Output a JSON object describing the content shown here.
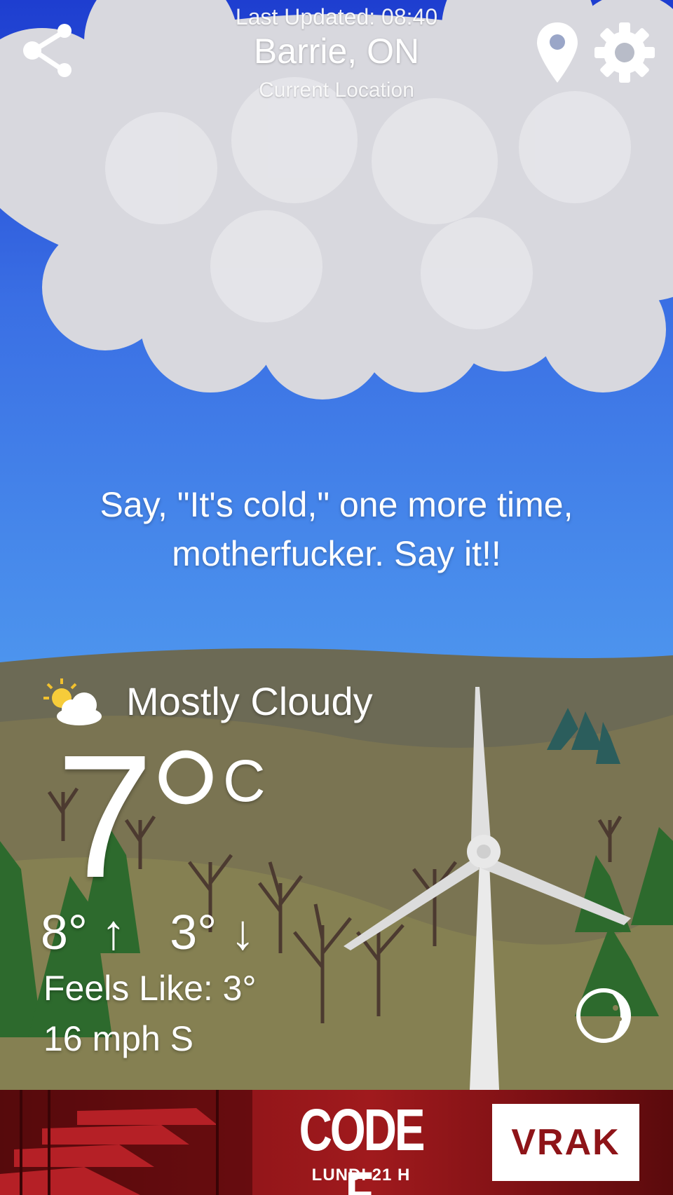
{
  "header": {
    "last_updated": "Last Updated: 08:40",
    "city": "Barrie, ON",
    "location_label": "Current Location",
    "share_icon": "share-icon",
    "pin_icon": "location-pin-icon",
    "settings_icon": "gear-icon"
  },
  "quote": {
    "line1": "Say, \"It's cold,\" one more time,",
    "line2": "motherfucker. Say it!!"
  },
  "weather": {
    "condition_icon": "partly-cloudy-icon",
    "condition": "Mostly Cloudy",
    "temperature": "7",
    "unit": "C",
    "high": "8°",
    "low": "3°",
    "high_arrow": "↑",
    "low_arrow": "↓",
    "feels_like": "Feels Like: 3°",
    "wind": "16 mph S",
    "moon_icon": "moon-phase-icon"
  },
  "ad": {
    "title": "CODE F.",
    "subtitle": "LUNDI 21 H",
    "logo": "VRAK",
    "accent": "#8e1418"
  },
  "colors": {
    "sky_top": "#2a52d8",
    "sky_bottom": "#4a90ee",
    "hill": "#6f6a4c",
    "ground": "#7a7448"
  }
}
